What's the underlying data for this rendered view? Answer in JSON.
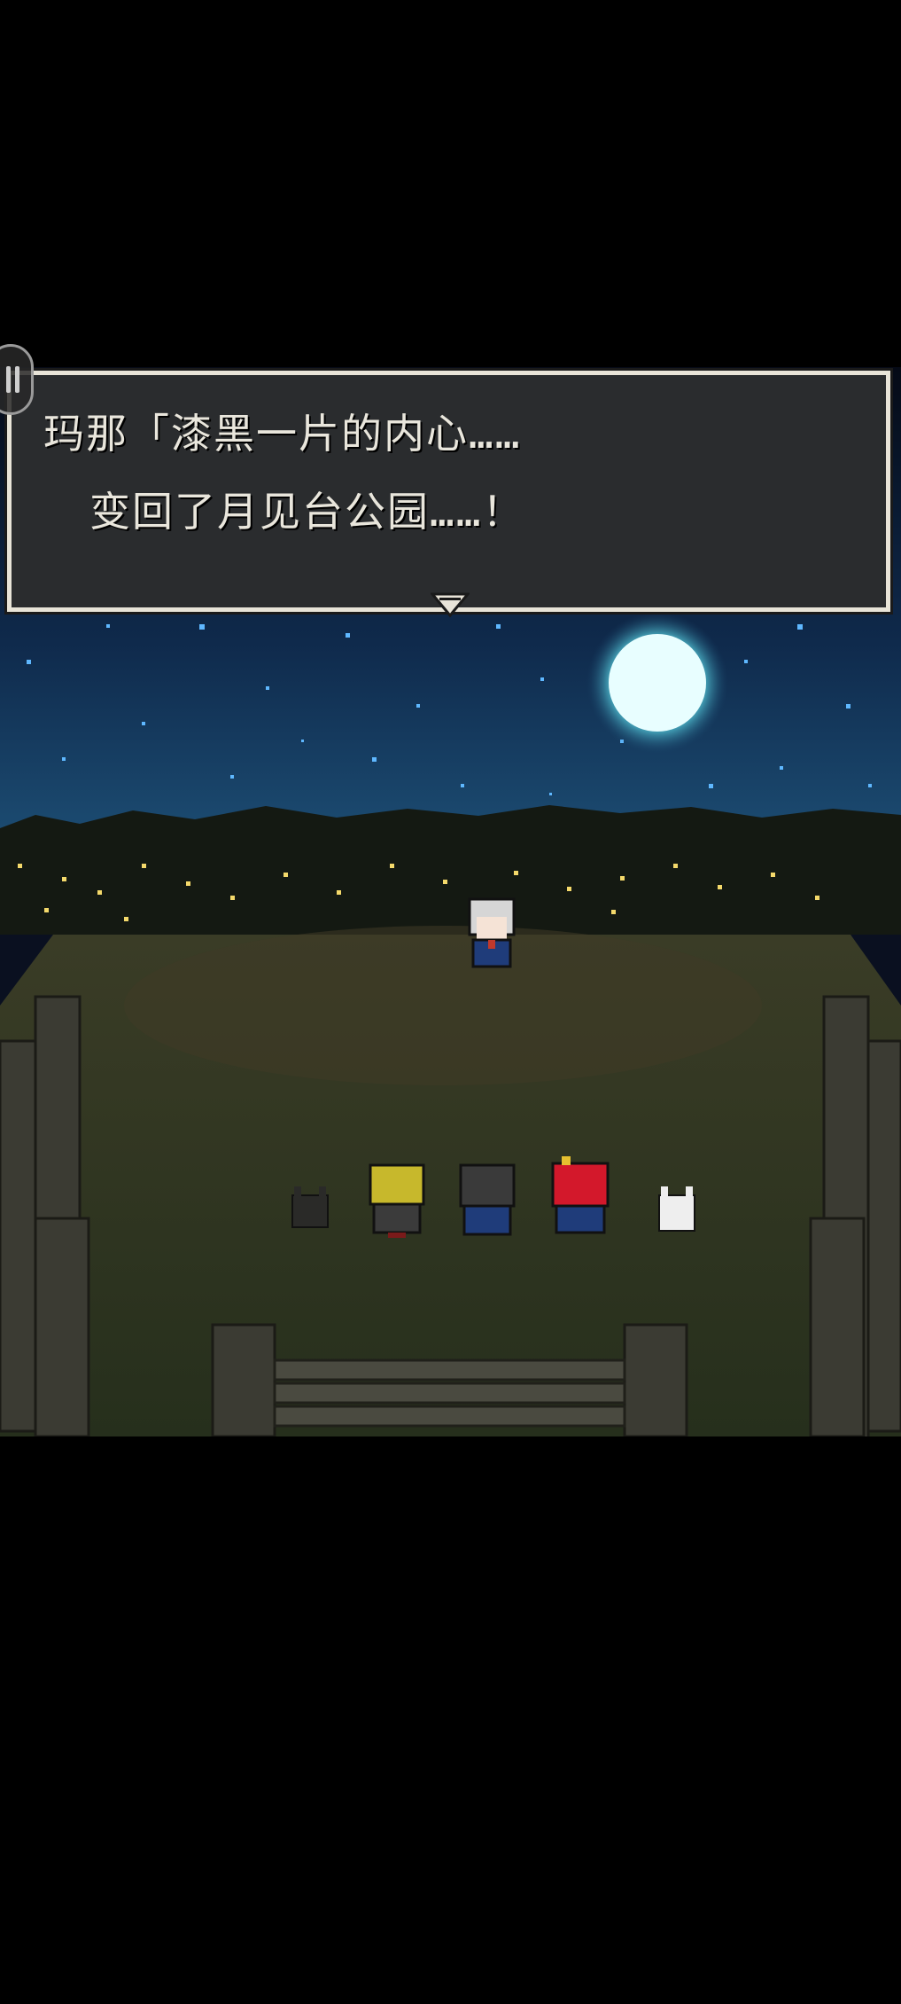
{
  "dialog": {
    "speaker_line": "玛那「漆黑一片的内心……",
    "second_line": "变回了月见台公园……！",
    "advance_icon": "triangle-down-icon"
  },
  "hud": {
    "menu_button_icon": "pause-icon"
  },
  "colors": {
    "sky": "#0b1a33",
    "moon": "#dffaff",
    "dialog_bg": "#2a2c2e",
    "dialog_border": "#e8e4d8",
    "ground": "#2d3522"
  },
  "characters": [
    {
      "id": "silver-haired-girl",
      "icon": "silver-haired-girl-sprite"
    },
    {
      "id": "black-cat",
      "icon": "black-cat-sprite"
    },
    {
      "id": "blonde-boy",
      "icon": "blonde-boy-sprite"
    },
    {
      "id": "dark-haired-girl",
      "icon": "dark-haired-girl-sprite"
    },
    {
      "id": "red-haired-girl",
      "icon": "red-haired-girl-sprite"
    },
    {
      "id": "white-cat",
      "icon": "white-cat-sprite"
    }
  ]
}
